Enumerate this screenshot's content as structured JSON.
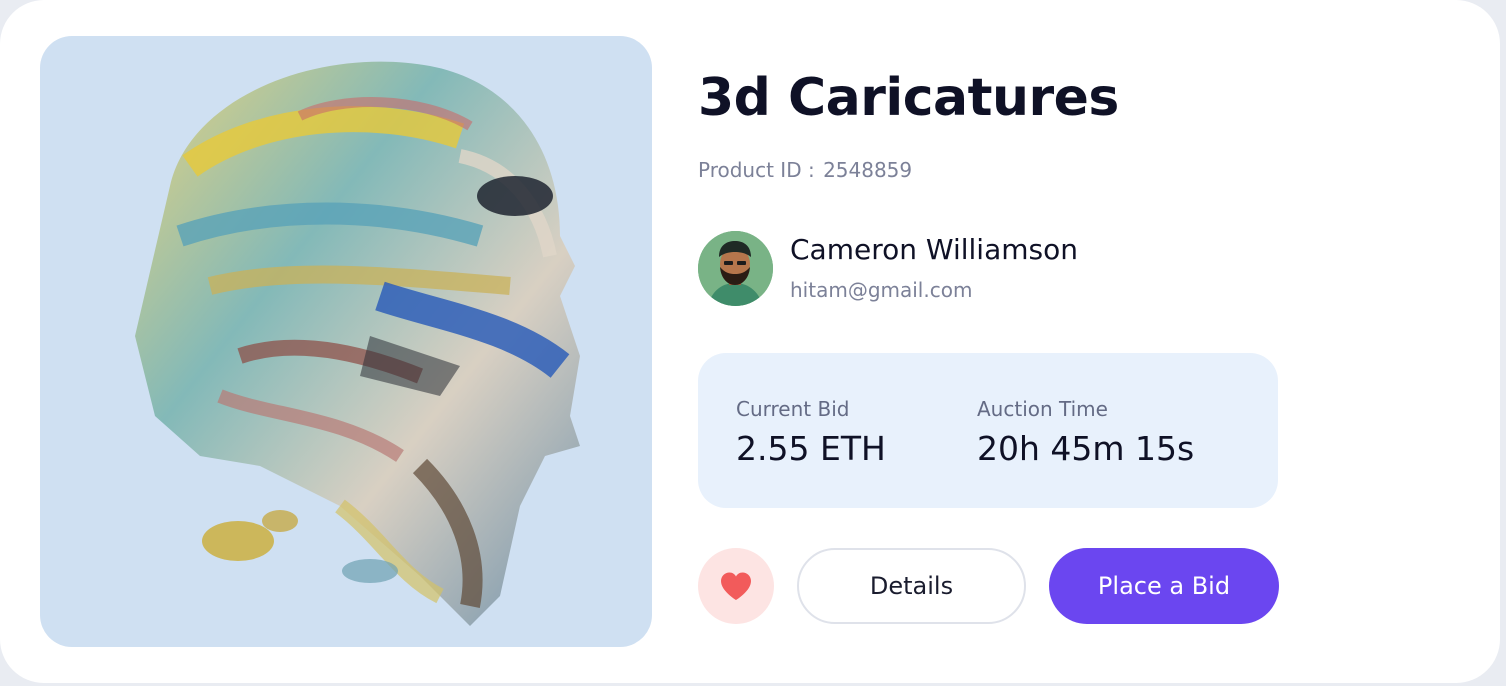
{
  "product": {
    "title": "3d Caricatures",
    "id_label": "Product ID :",
    "id_value": "2548859",
    "image_icon": "abstract-painted-head-artwork"
  },
  "owner": {
    "name": "Cameron Williamson",
    "email": "hitam@gmail.com",
    "avatar_icon": "bearded-man-avatar"
  },
  "auction": {
    "current_bid_label": "Current Bid",
    "current_bid_value": "2.55 ETH",
    "time_label": "Auction Time",
    "time_value": "20h 45m 15s"
  },
  "actions": {
    "favorite_icon": "heart-icon",
    "details_label": "Details",
    "place_bid_label": "Place a Bid"
  },
  "colors": {
    "accent": "#6b46f0",
    "heart": "#f25b5b",
    "bid_box_bg": "#e8f1fc",
    "artwork_bg": "#cfe0f2",
    "text_dark": "#0f1126",
    "text_muted": "#7c8198"
  }
}
